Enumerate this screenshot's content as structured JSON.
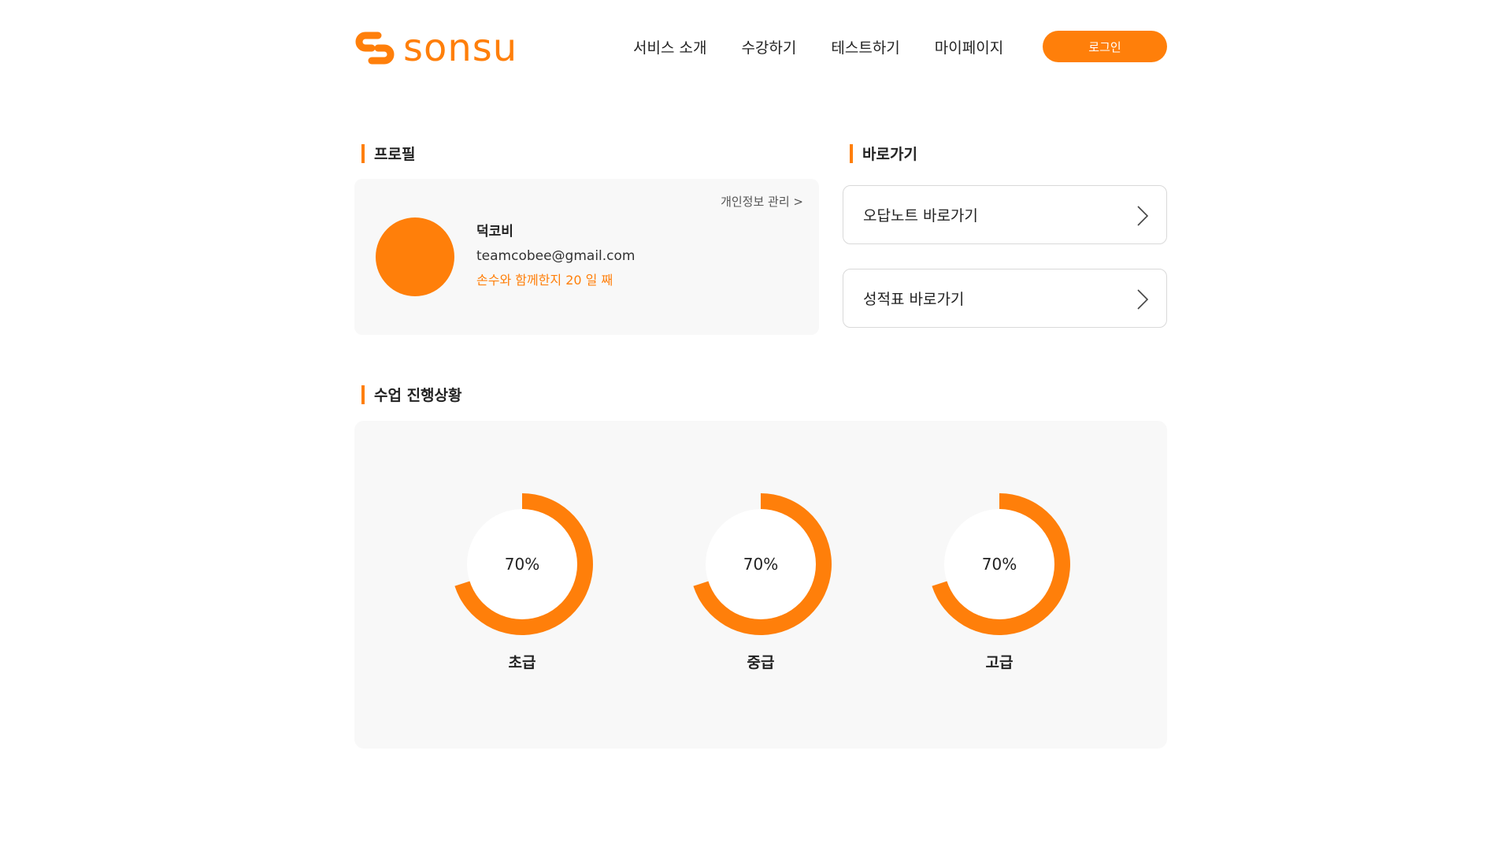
{
  "header": {
    "logo_text": "sonsu",
    "nav": [
      "서비스 소개",
      "수강하기",
      "테스트하기",
      "마이페이지"
    ],
    "login_label": "로그인"
  },
  "profile": {
    "section_title": "프로필",
    "privacy_link": "개인정보 관리",
    "name": "덕코비",
    "email": "teamcobee@gmail.com",
    "days_text": "손수와 함께한지 20 일 째"
  },
  "shortcuts": {
    "section_title": "바로가기",
    "items": [
      "오답노트 바로가기",
      "성적표 바로가기"
    ]
  },
  "progress": {
    "section_title": "수업 진행상황",
    "items": [
      {
        "label": "초급",
        "percent_text": "70%",
        "value": 70
      },
      {
        "label": "중급",
        "percent_text": "70%",
        "value": 70
      },
      {
        "label": "고급",
        "percent_text": "70%",
        "value": 70
      }
    ]
  },
  "colors": {
    "accent": "#FF7F0A",
    "panel": "#F8F8F8"
  }
}
